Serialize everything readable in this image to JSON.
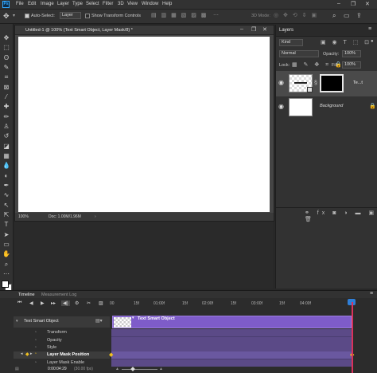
{
  "menubar": {
    "logo": "Ps",
    "items": [
      "File",
      "Edit",
      "Image",
      "Layer",
      "Type",
      "Select",
      "Filter",
      "3D",
      "View",
      "Window",
      "Help"
    ],
    "window_controls": {
      "minimize": "–",
      "restore": "❐",
      "close": "✕"
    }
  },
  "options": {
    "auto_select_label": "Auto-Select:",
    "auto_select_value": "Layer",
    "show_transform_label": "Show Transform Controls",
    "mode_3d": "3D Mode:"
  },
  "document": {
    "tab_title": "Untitled-1 @ 100% (Text Smart Object, Layer Mask/8) *",
    "zoom": "100%",
    "doc_info": "Doc: 1.00M/1.96M"
  },
  "layers": {
    "tab": "Layers",
    "kind_label": "Kind",
    "blend_mode": "Normal",
    "opacity_label": "Opacity:",
    "opacity_value": "100%",
    "lock_label": "Lock:",
    "fill_label": "Fill:",
    "fill_value": "100%",
    "items": [
      {
        "name": "Te...t",
        "visible": true
      },
      {
        "name": "Background",
        "visible": true
      }
    ]
  },
  "timeline": {
    "tab_timeline": "Timeline",
    "tab_measurement": "Measurement Log",
    "ruler_labels": [
      "00",
      "15f",
      "01:00f",
      "15f",
      "02:00f",
      "15f",
      "03:00f",
      "15f",
      "04:00f"
    ],
    "track_name": "Text Smart Object",
    "clip_label": "Text Smart Object",
    "properties": [
      "Transform",
      "Opacity",
      "Style",
      "Layer Mask Position",
      "Layer Mask Enable"
    ],
    "current_time": "0:00:04:29",
    "fps": "(30.00 fps)"
  },
  "colors": {
    "accent": "#31a8ff",
    "track": "#5b4a87",
    "clip": "#7e5cc9",
    "playhead": "#d9325b",
    "keyframe": "#f0c020"
  }
}
